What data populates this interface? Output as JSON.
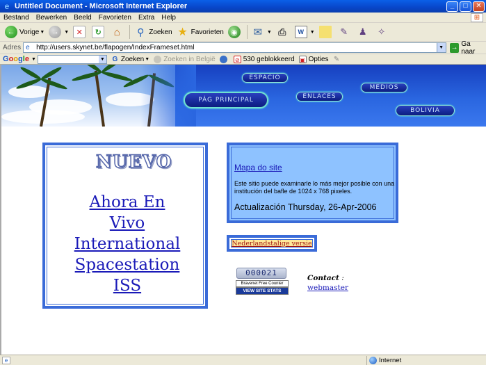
{
  "window": {
    "title": "Untitled Document - Microsoft Internet Explorer",
    "minimize_glyph": "_",
    "maximize_glyph": "□",
    "close_glyph": "✕"
  },
  "menu": [
    "Bestand",
    "Bewerken",
    "Beeld",
    "Favorieten",
    "Extra",
    "Help"
  ],
  "toolbar": {
    "back_label": "Vorige",
    "search_label": "Zoeken",
    "favorites_label": "Favorieten"
  },
  "address": {
    "label": "Adres",
    "url": "http://users.skynet.be/flapogen/IndexFrameset.html",
    "go_label": "Ga naar"
  },
  "google_bar": {
    "logo": [
      "G",
      "o",
      "o",
      "g",
      "l",
      "e"
    ],
    "search_label": "Zoeken",
    "search_belgium_label": "Zoeken in België",
    "blocked_label": "530 geblokkeerd",
    "options_label": "Opties"
  },
  "banner": {
    "nav": {
      "espacio": "ESPACIO",
      "principal": "PÁG PRINCIPAL",
      "enlaces": "ENLACES",
      "medios": "MEDIOS",
      "bolivia": "BOLIVIA"
    }
  },
  "main": {
    "nuevo_text": "NUEVO",
    "headline_lines": [
      "Ahora En",
      "Vivo",
      "International",
      "Spacestation",
      "ISS"
    ],
    "sitemap_link": "Mapa do site",
    "sitemap_desc": "Este sitio puede examinarle lo más mejor posible con una institución del bafle de 1024 x 768 pixeles.",
    "update_text": "Actualización Thursday, 26-Apr-2006",
    "dutch_link": "Nederlandstalige versie",
    "counter_value": "000021",
    "counter_label": "Bravenet Free Counter",
    "counter_stats": "VIEW SITE STATS",
    "contact_label": "Contact",
    "contact_colon": " :",
    "webmaster_link": "webmaster"
  },
  "status": {
    "zone_label": "Internet"
  },
  "colors": {
    "accent_blue": "#3a6bd8",
    "link_color": "#1a1ab8",
    "info_box_bg": "#8ec2ff"
  }
}
